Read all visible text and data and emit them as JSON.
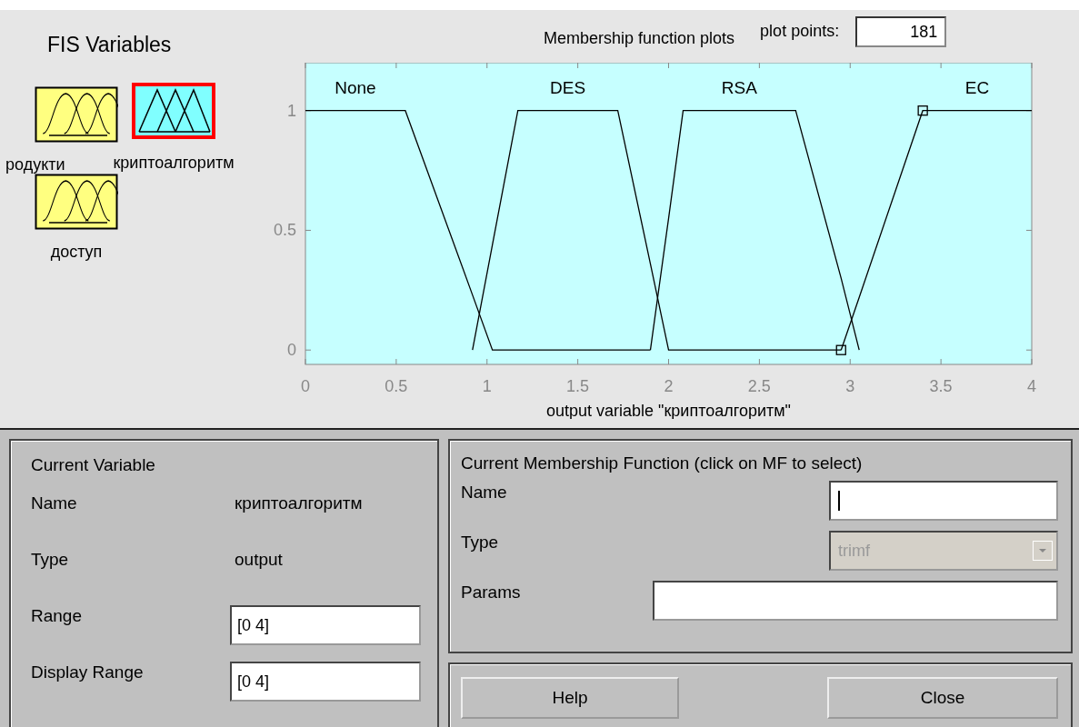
{
  "fis_variables": {
    "title": "FIS Variables",
    "variables": [
      {
        "label": "родукти",
        "kind": "input",
        "selected": false
      },
      {
        "label": "криптоалгоритм",
        "kind": "output",
        "selected": true
      },
      {
        "label": "доступ",
        "kind": "input",
        "selected": false
      }
    ]
  },
  "plot_header": {
    "title": "Membership function plots",
    "points_label": "plot points:",
    "points_value": "181"
  },
  "chart_data": {
    "type": "line",
    "xlabel": "output variable \"криптоалгоритм\"",
    "x": [
      0,
      0.55,
      0.92,
      1.03,
      1.17,
      1.72,
      1.9,
      2.0,
      2.08,
      2.7,
      2.95,
      3.05,
      3.4,
      4
    ],
    "series": [
      {
        "name": "None",
        "color": "#000000",
        "values": [
          1,
          1,
          0.23,
          0,
          0,
          0,
          0,
          null,
          null,
          null,
          null,
          null,
          null,
          null
        ]
      },
      {
        "name": "DES",
        "color": "#000000",
        "values": [
          null,
          null,
          0,
          0.44,
          1,
          1,
          0.36,
          0,
          0,
          0,
          0,
          null,
          null,
          null
        ]
      },
      {
        "name": "RSA",
        "color": "#000000",
        "values": [
          null,
          null,
          null,
          null,
          null,
          null,
          0,
          0.55,
          1,
          1,
          0.3,
          0,
          null,
          null
        ]
      },
      {
        "name": "EC",
        "color": "#000000",
        "values": [
          null,
          null,
          null,
          null,
          null,
          null,
          null,
          null,
          null,
          null,
          0,
          0.22,
          1,
          1
        ]
      }
    ],
    "xlim": [
      0,
      4
    ],
    "ylim": [
      -0.06,
      1.2
    ],
    "xticks": [
      0,
      0.5,
      1,
      1.5,
      2,
      2.5,
      3,
      3.5,
      4
    ],
    "yticks": [
      0,
      0.5,
      1
    ]
  },
  "current_variable": {
    "title": "Current Variable",
    "rows": [
      {
        "label": "Name",
        "kind": "text",
        "value": "криптоалгоритм"
      },
      {
        "label": "Type",
        "kind": "text",
        "value": "output"
      },
      {
        "label": "Range",
        "kind": "input",
        "value": "[0 4]"
      },
      {
        "label": "Display Range",
        "kind": "input",
        "value": "[0 4]"
      }
    ]
  },
  "current_mf": {
    "title": "Current Membership Function (click on MF to select)",
    "rows": [
      {
        "label": "Name",
        "kind": "input",
        "focused": true
      },
      {
        "label": "Type",
        "kind": "select",
        "value": "trimf",
        "disabled": true
      },
      {
        "label": "Params",
        "kind": "wide_input"
      }
    ]
  },
  "buttons": [
    "Help",
    "Close"
  ]
}
